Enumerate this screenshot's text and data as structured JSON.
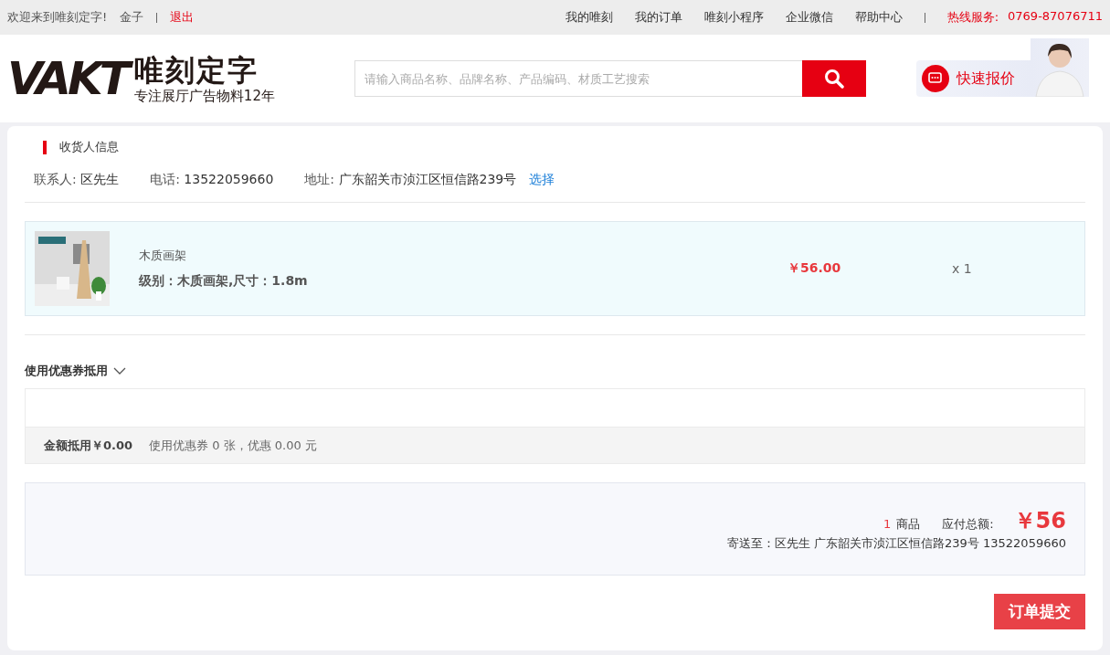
{
  "topbar": {
    "welcome": "欢迎来到唯刻定字!",
    "user": "金子",
    "logout": "退出",
    "links": [
      "我的唯刻",
      "我的订单",
      "唯刻小程序",
      "企业微信",
      "帮助中心"
    ],
    "hotline_label": "热线服务:",
    "hotline": "0769-87076711"
  },
  "header": {
    "logo_mark": "VAKT",
    "logo_name": "唯刻定字",
    "logo_slogan": "专注展厅广告物料12年",
    "search": {
      "placeholder": "请输入商品名称、品牌名称、产品编码、材质工艺搜索"
    },
    "quote_button": "快速报价"
  },
  "consignee": {
    "title": "收货人信息",
    "contact_label": "联系人:",
    "contact": "区先生",
    "phone_label": "电话:",
    "phone": "13522059660",
    "address_label": "地址:",
    "address": "广东韶关市浈江区恒信路239号",
    "choose": "选择"
  },
  "items": [
    {
      "name": "木质画架",
      "spec": "级别：木质画架,尺寸：1.8m",
      "price": "￥56.00",
      "quantity": "x 1"
    }
  ],
  "coupon": {
    "title": "使用优惠券抵用",
    "expanded": false,
    "amount": "金额抵用￥0.00",
    "summary": "使用优惠券 0 张，优惠 0.00 元"
  },
  "summary": {
    "count": "1",
    "count_label": "商品",
    "total_label": "应付总额:",
    "total": "￥56",
    "ship_to": "寄送至：区先生 广东韶关市浈江区恒信路239号 13522059660"
  },
  "submit_button": "订单提交"
}
